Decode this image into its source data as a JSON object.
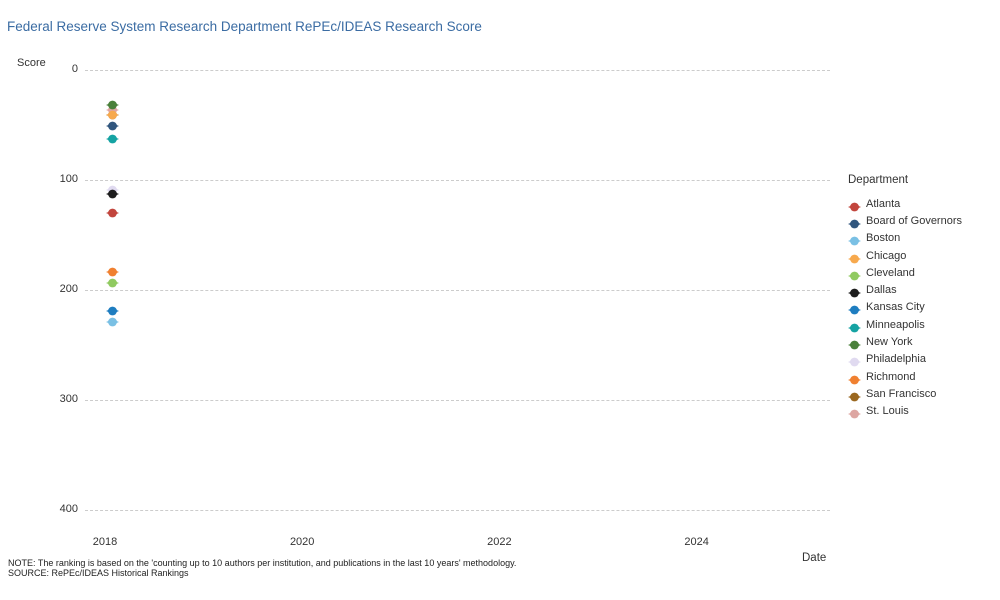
{
  "title": "Federal Reserve System Research Department RePEc/IDEAS Research Score",
  "axes": {
    "y_label": "Score",
    "x_label": "Date"
  },
  "legend": {
    "title": "Department",
    "position": "right"
  },
  "notes": {
    "note": "NOTE: The ranking is based on the 'counting up to 10 authors per institution, and publications in the last 10 years' methodology.",
    "source": "SOURCE: RePEc/IDEAS Historical Rankings"
  },
  "colors": {
    "title_text": "#3b6ca3",
    "grid": "#cccccc",
    "axis_text": "#333333"
  },
  "chart_data": {
    "type": "scatter",
    "title": "Federal Reserve System Research Department RePEc/IDEAS Research Score",
    "xlabel": "Date",
    "ylabel": "Score",
    "x_ticks": [
      2018,
      2020,
      2022,
      2024
    ],
    "y_ticks": [
      0,
      100,
      200,
      300,
      400
    ],
    "ylim": [
      0,
      400
    ],
    "y_axis_reversed": true,
    "grid": "horizontal-dashed",
    "legend_position": "right",
    "date_approx": "2018",
    "series": [
      {
        "name": "Atlanta",
        "color": "#c2453d",
        "score": 127
      },
      {
        "name": "Board of Governors",
        "color": "#31567e",
        "score": 48
      },
      {
        "name": "Boston",
        "color": "#7ac0e4",
        "score": 226
      },
      {
        "name": "Chicago",
        "color": "#f7a94d",
        "score": 38
      },
      {
        "name": "Cleveland",
        "color": "#90ca60",
        "score": 191
      },
      {
        "name": "Dallas",
        "color": "#1d1d1d",
        "score": 110
      },
      {
        "name": "Kansas City",
        "color": "#1e7dc0",
        "score": 216
      },
      {
        "name": "Minneapolis",
        "color": "#15a3a3",
        "score": 60
      },
      {
        "name": "New York",
        "color": "#49803a",
        "score": 29
      },
      {
        "name": "Philadelphia",
        "color": "#e0daf0",
        "score": 106
      },
      {
        "name": "Richmond",
        "color": "#f08030",
        "score": 181
      },
      {
        "name": "San Francisco",
        "color": "#9a671f",
        "score": 38
      },
      {
        "name": "St. Louis",
        "color": "#dda6a2",
        "score": 34
      }
    ],
    "draw_order": [
      "San Francisco",
      "St. Louis",
      "Philadelphia",
      "New York",
      "Chicago",
      "Board of Governors",
      "Minneapolis",
      "Dallas",
      "Atlanta",
      "Richmond",
      "Cleveland",
      "Kansas City",
      "Boston"
    ]
  }
}
